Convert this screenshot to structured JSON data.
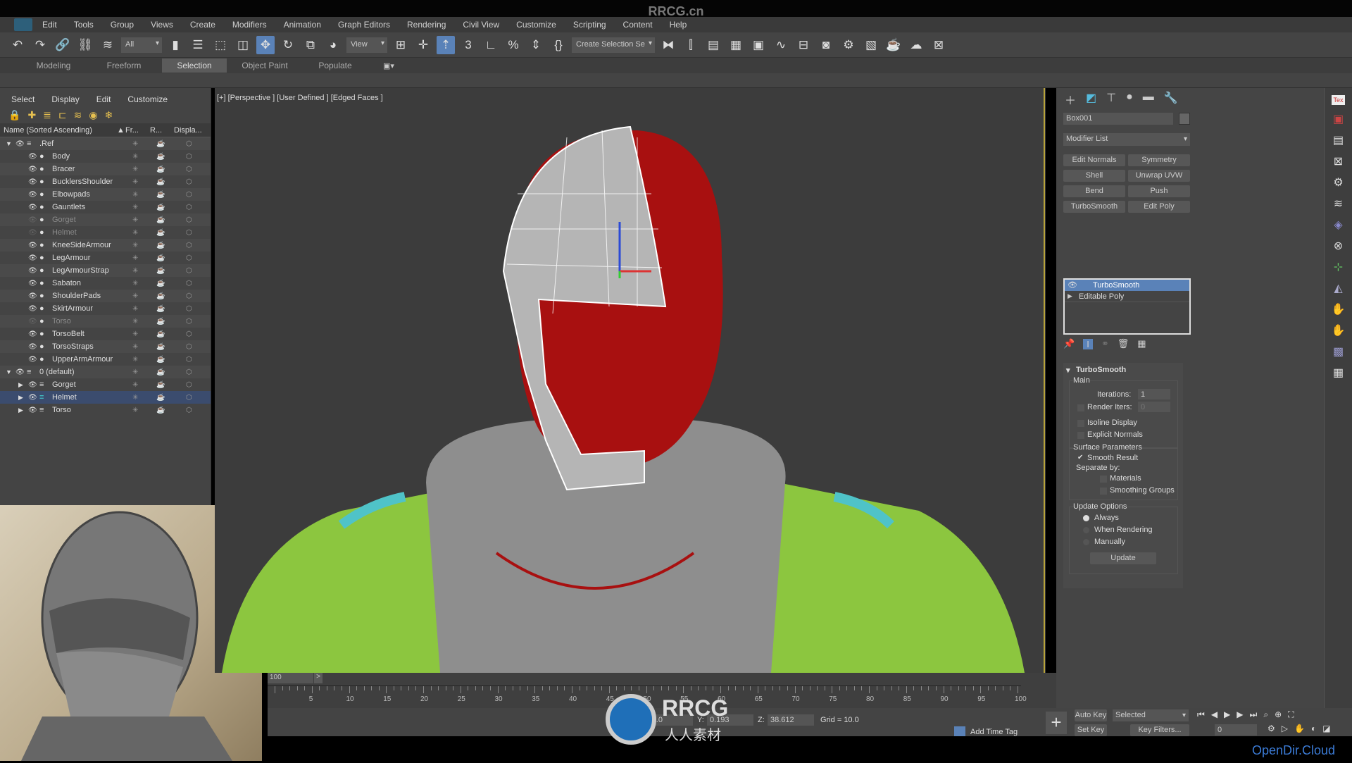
{
  "watermarks": {
    "top": "RRCG.cn",
    "center_logo": "RRCG",
    "center_sub": "人人素材",
    "bottom_right": "OpenDir.Cloud"
  },
  "menu": [
    "Edit",
    "Tools",
    "Group",
    "Views",
    "Create",
    "Modifiers",
    "Animation",
    "Graph Editors",
    "Rendering",
    "Civil View",
    "Customize",
    "Scripting",
    "Content",
    "Help"
  ],
  "toolbar": {
    "filter_dropdown": "All",
    "coord_dropdown": "View",
    "selection_set": "Create Selection Se"
  },
  "ribbon": {
    "tabs": [
      "Modeling",
      "Freeform",
      "Selection",
      "Object Paint",
      "Populate"
    ],
    "active": "Selection"
  },
  "explorer": {
    "menu": [
      "Select",
      "Display",
      "Edit",
      "Customize"
    ],
    "columns": {
      "name": "Name (Sorted Ascending)",
      "frozen": "Fr...",
      "render": "R...",
      "display": "Displa..."
    },
    "rows": [
      {
        "name": ".Ref",
        "level": 0,
        "layer": true,
        "expanded": true,
        "visible": true
      },
      {
        "name": "Body",
        "level": 1,
        "visible": true
      },
      {
        "name": "Bracer",
        "level": 1,
        "visible": true
      },
      {
        "name": "BucklersShoulder",
        "level": 1,
        "visible": true
      },
      {
        "name": "Elbowpads",
        "level": 1,
        "visible": true
      },
      {
        "name": "Gauntlets",
        "level": 1,
        "visible": true
      },
      {
        "name": "Gorget",
        "level": 1,
        "visible": false
      },
      {
        "name": "Helmet",
        "level": 1,
        "visible": false
      },
      {
        "name": "KneeSideArmour",
        "level": 1,
        "visible": true
      },
      {
        "name": "LegArmour",
        "level": 1,
        "visible": true
      },
      {
        "name": "LegArmourStrap",
        "level": 1,
        "visible": true
      },
      {
        "name": "Sabaton",
        "level": 1,
        "visible": true
      },
      {
        "name": "ShoulderPads",
        "level": 1,
        "visible": true
      },
      {
        "name": "SkirtArmour",
        "level": 1,
        "visible": true
      },
      {
        "name": "Torso",
        "level": 1,
        "visible": false
      },
      {
        "name": "TorsoBelt",
        "level": 1,
        "visible": true
      },
      {
        "name": "TorsoStraps",
        "level": 1,
        "visible": true
      },
      {
        "name": "UpperArmArmour",
        "level": 1,
        "visible": true
      },
      {
        "name": "0 (default)",
        "level": 0,
        "layer": true,
        "expanded": true,
        "visible": true
      },
      {
        "name": "Gorget",
        "level": 1,
        "collapsed": true,
        "visible": true
      },
      {
        "name": "Helmet",
        "level": 1,
        "collapsed": true,
        "visible": true,
        "selected": true
      },
      {
        "name": "Torso",
        "level": 1,
        "collapsed": true,
        "visible": true
      }
    ]
  },
  "viewport": {
    "label": "[+] [Perspective ] [User Defined ] [Edged Faces ]"
  },
  "command_panel": {
    "object_name": "Box001",
    "modifier_list": "Modifier List",
    "buttons": [
      "Edit Normals",
      "Symmetry",
      "Shell",
      "Unwrap UVW",
      "Bend",
      "Push",
      "TurboSmooth",
      "Edit Poly"
    ],
    "stack": [
      {
        "name": "TurboSmooth",
        "selected": true
      },
      {
        "name": "Editable Poly",
        "selected": false
      }
    ],
    "rollout": {
      "title": "TurboSmooth",
      "main": "Main",
      "iterations_label": "Iterations:",
      "iterations": "1",
      "render_iters_label": "Render Iters:",
      "render_iters": "0",
      "isoline": "Isoline Display",
      "explicit": "Explicit Normals",
      "surface": "Surface Parameters",
      "smooth_result": "Smooth Result",
      "separate": "Separate by:",
      "materials": "Materials",
      "smoothing_groups": "Smoothing Groups",
      "update_options": "Update Options",
      "always": "Always",
      "when_rendering": "When Rendering",
      "manually": "Manually",
      "update_btn": "Update",
      "selected_update": "Always",
      "smooth_checked": true
    }
  },
  "timeline": {
    "frame": "100",
    "ticks": [
      "5",
      "10",
      "15",
      "20",
      "25",
      "30",
      "35",
      "40",
      "45",
      "50",
      "55",
      "60",
      "65",
      "70",
      "75",
      "80",
      "85",
      "90",
      "95",
      "100"
    ]
  },
  "status": {
    "x_label": "X:",
    "x": "-0.0",
    "y_label": "Y:",
    "y": "0.193",
    "z_label": "Z:",
    "z": "38.612",
    "grid": "Grid = 10.0",
    "add_time_tag": "Add Time Tag",
    "auto_key": "Auto Key",
    "set_key": "Set Key",
    "key_mode": "Selected",
    "key_filters": "Key Filters...",
    "current_frame": "0"
  },
  "colors": {
    "accent": "#5a82b8",
    "head": "#a81010",
    "shoulders": "#8cc63f",
    "gorget": "#8e8e8e",
    "cyan": "#4fc3c8"
  }
}
